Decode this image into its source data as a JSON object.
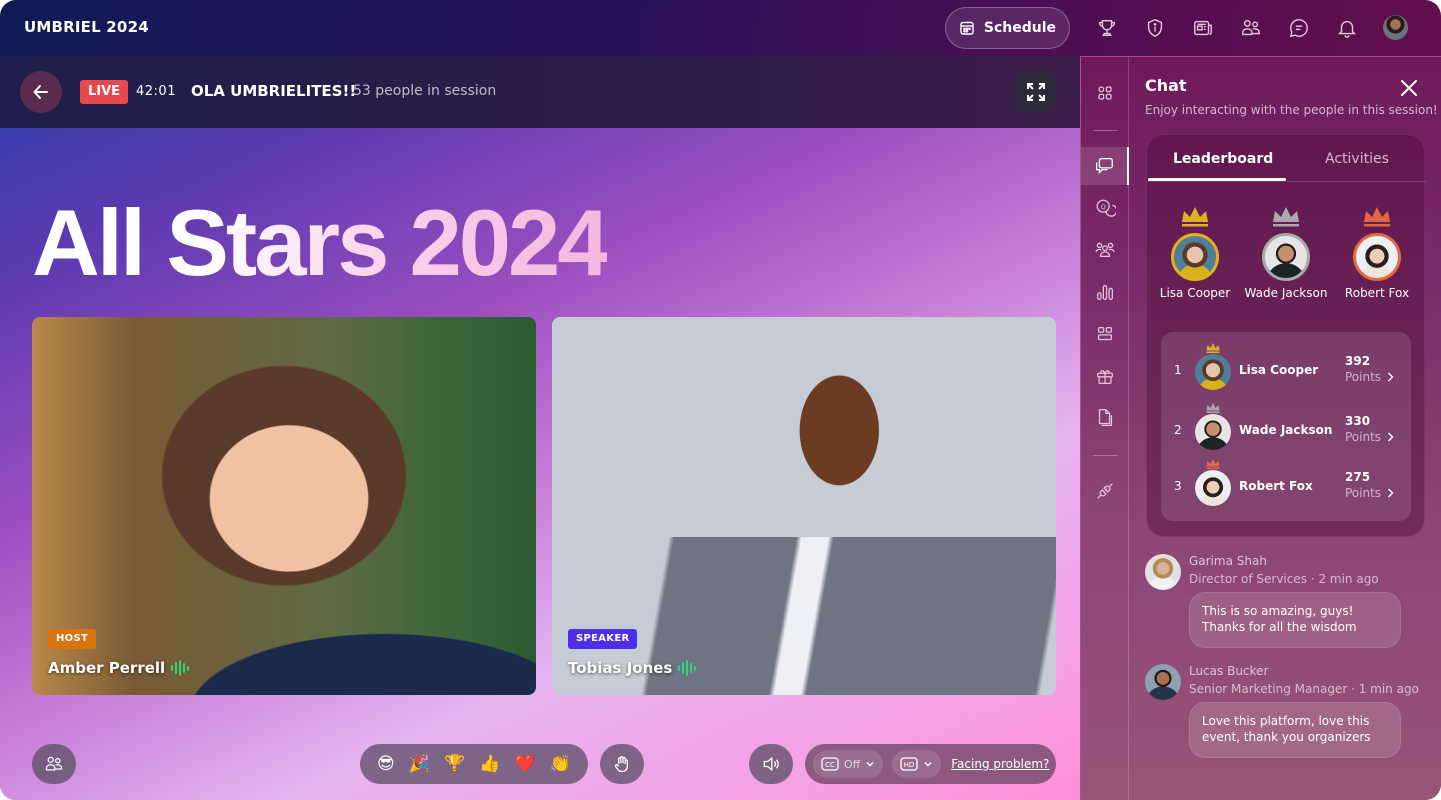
{
  "app": {
    "brand": "UMBRIEL 2024"
  },
  "topbar": {
    "schedule_label": "Schedule",
    "icons": [
      "trophy-icon",
      "info-shield-icon",
      "news-icon",
      "people-icon",
      "chat-bubble-icon",
      "bell-icon"
    ]
  },
  "session": {
    "live_label": "LIVE",
    "timer": "42:01",
    "title": "OLA UMBRIELITES!!",
    "people_count": "53 people in session"
  },
  "stage": {
    "hero_title": "All Stars 2024",
    "tiles": [
      {
        "role": "HOST",
        "name": "Amber Perrell",
        "role_color": "#d9730d",
        "speaking": true
      },
      {
        "role": "SPEAKER",
        "name": "Tobias Jones",
        "role_color": "#4f2ee8",
        "speaking": true
      }
    ]
  },
  "controls": {
    "reactions": [
      "😎",
      "🎉",
      "🏆",
      "👍",
      "❤️",
      "👏"
    ],
    "reaction_names": [
      "cool",
      "party",
      "trophy",
      "thumbs-up",
      "heart",
      "clap"
    ],
    "cc_label": "Off",
    "quality_label": "HD",
    "cc_badge": "CC",
    "facing_problem": "Facing problem?"
  },
  "panel": {
    "title": "Chat",
    "subtitle": "Enjoy interacting with the people in this session!",
    "tabs": [
      "Leaderboard",
      "Activities"
    ],
    "active_tab": "Leaderboard",
    "podium": [
      {
        "name": "Lisa Cooper",
        "color": "#e0b21f"
      },
      {
        "name": "Wade Jackson",
        "color": "#a9a9ad"
      },
      {
        "name": "Robert Fox",
        "color": "#e0693f"
      }
    ],
    "leaderboard": [
      {
        "rank": "1",
        "name": "Lisa Cooper",
        "points": "392",
        "points_label": "Points"
      },
      {
        "rank": "2",
        "name": "Wade Jackson",
        "points": "330",
        "points_label": "Points"
      },
      {
        "rank": "3",
        "name": "Robert Fox",
        "points": "275",
        "points_label": "Points"
      }
    ],
    "messages": [
      {
        "name": "Garima Shah",
        "meta": "Director of Services · 2 min ago",
        "text": "This is so amazing, guys! Thanks for all the wisdom"
      },
      {
        "name": "Lucas Bucker",
        "meta": "Senior Marketing Manager · 1 min ago",
        "text": "Love this platform, love this event, thank you organizers"
      }
    ]
  },
  "colors": {
    "live": "#e5484d",
    "speaking": "#2ed37a",
    "gold": "#e0b21f",
    "silver": "#a9a9ad",
    "bronze": "#e0693f"
  }
}
